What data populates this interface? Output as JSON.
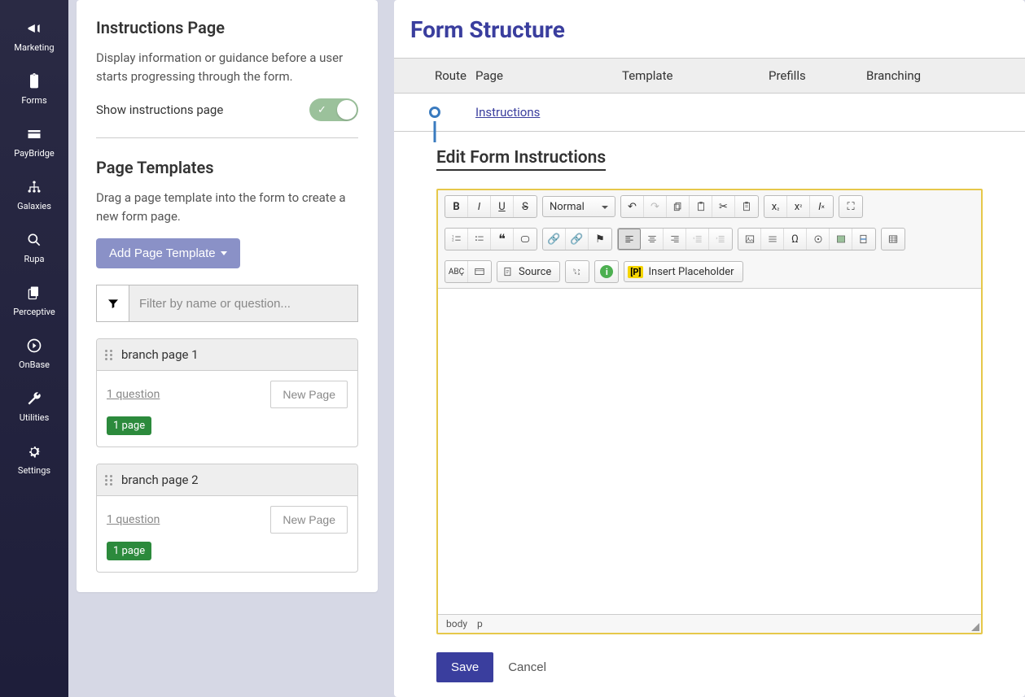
{
  "sidebar": {
    "items": [
      {
        "label": "Marketing"
      },
      {
        "label": "Forms"
      },
      {
        "label": "PayBridge"
      },
      {
        "label": "Galaxies"
      },
      {
        "label": "Rupa"
      },
      {
        "label": "Perceptive"
      },
      {
        "label": "OnBase"
      },
      {
        "label": "Utilities"
      },
      {
        "label": "Settings"
      }
    ]
  },
  "left": {
    "instructions_title": "Instructions Page",
    "instructions_desc": "Display information or guidance before a user starts progressing through the form.",
    "toggle_label": "Show instructions page",
    "templates_title": "Page Templates",
    "templates_desc": "Drag a page template into the form to create a new form page.",
    "add_template_btn": "Add Page Template",
    "filter_placeholder": "Filter by name or question...",
    "templates": [
      {
        "name": "branch page 1",
        "question_text": "1 question",
        "badge": "1 page",
        "new_page_btn": "New Page"
      },
      {
        "name": "branch page 2",
        "question_text": "1 question",
        "badge": "1 page",
        "new_page_btn": "New Page"
      }
    ]
  },
  "right": {
    "title": "Form Structure",
    "columns": {
      "route": "Route",
      "page": "Page",
      "template": "Template",
      "prefills": "Prefills",
      "branching": "Branching"
    },
    "row_instructions": "Instructions",
    "edit_heading": "Edit Form Instructions",
    "editor": {
      "format_dropdown": "Normal",
      "source_btn": "Source",
      "insert_placeholder": "Insert Placeholder",
      "insert_p": "[P]",
      "path_body": "body",
      "path_p": "p"
    },
    "save_btn": "Save",
    "cancel_btn": "Cancel"
  }
}
